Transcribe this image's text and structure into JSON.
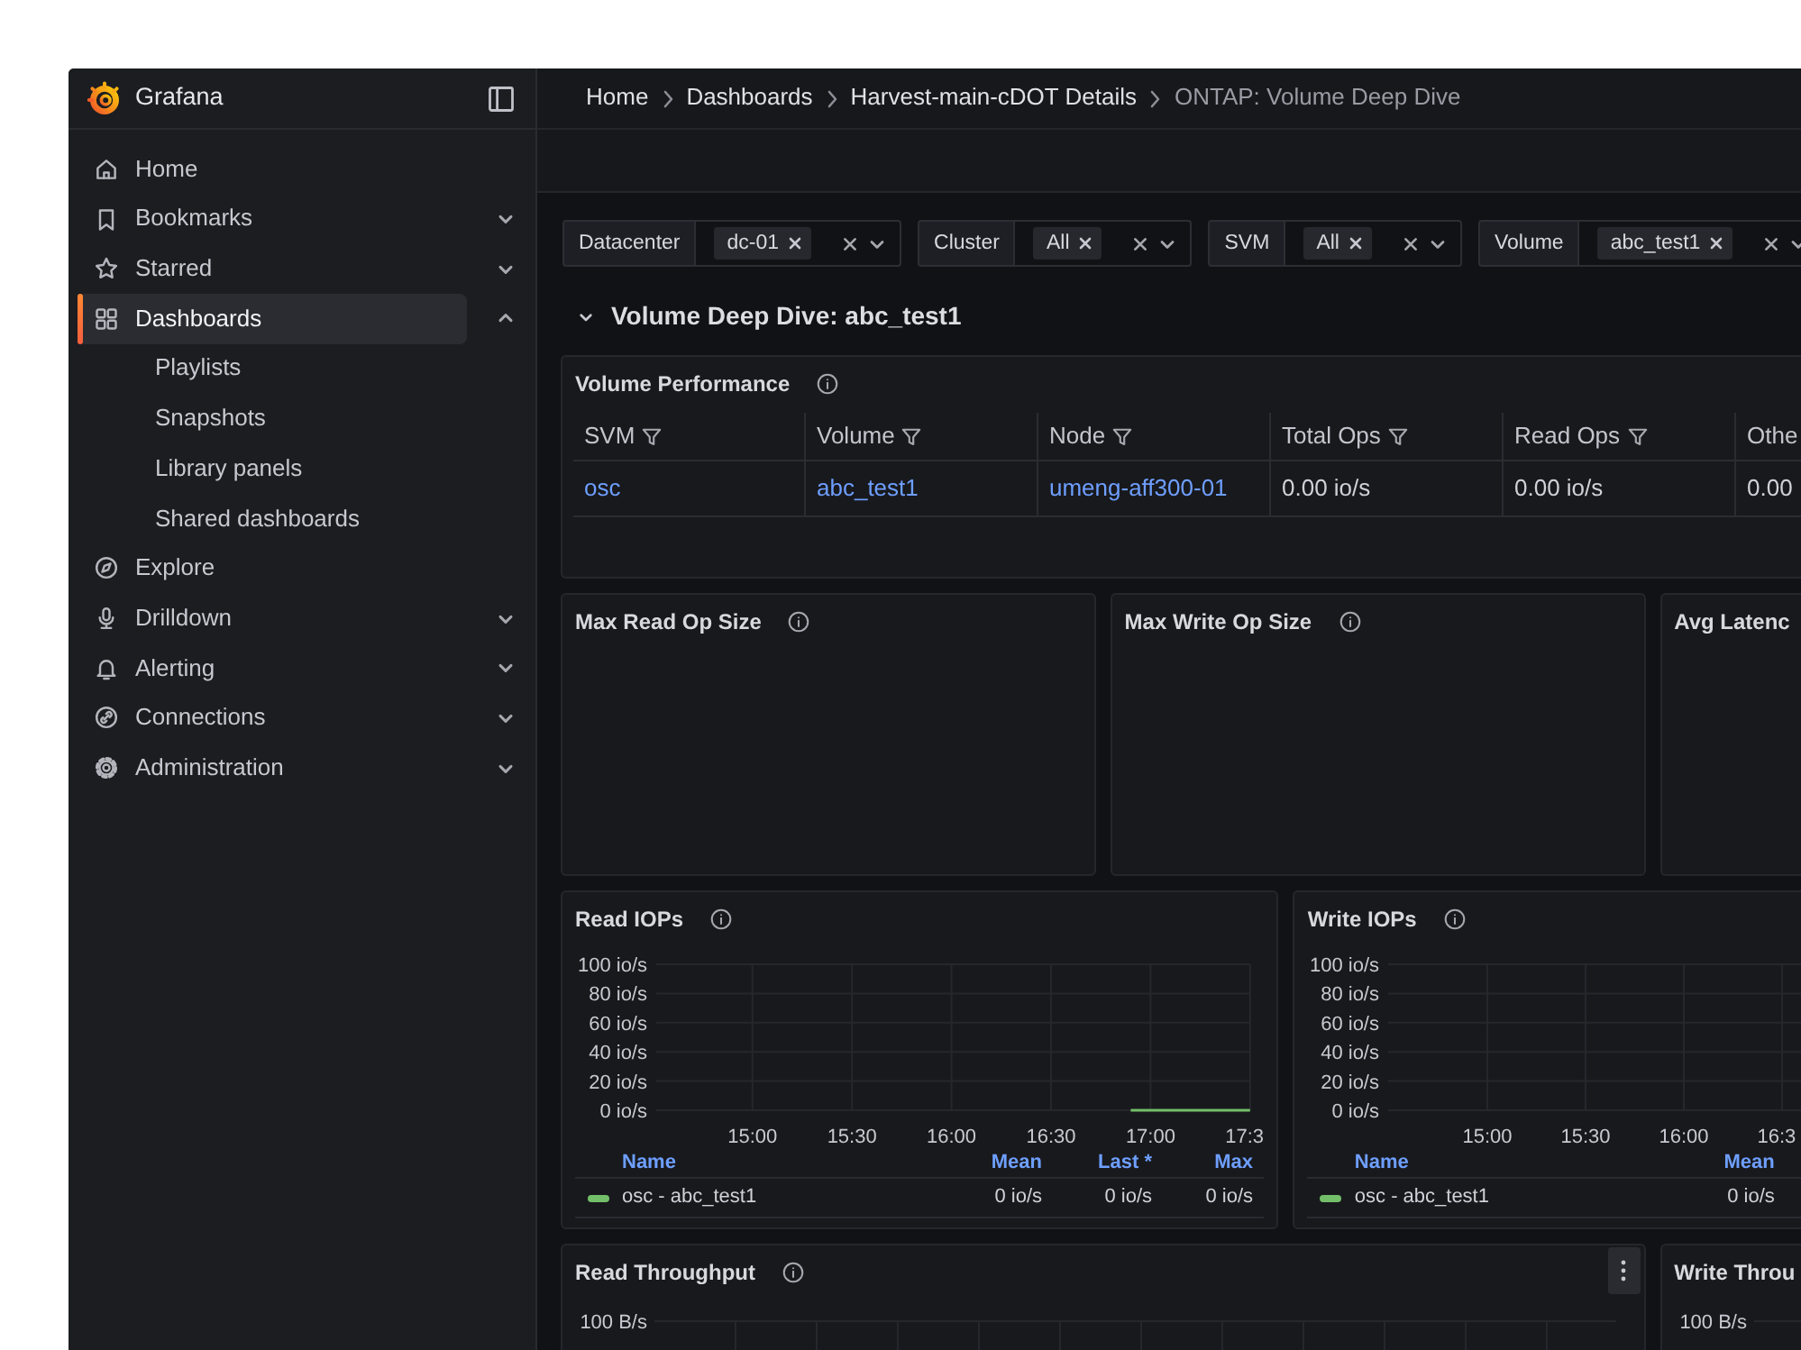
{
  "sidebar": {
    "brand": "Grafana",
    "items": [
      {
        "label": "Home",
        "kind": "link",
        "selected": false
      },
      {
        "label": "Bookmarks",
        "kind": "group",
        "selected": false,
        "expanded": false
      },
      {
        "label": "Starred",
        "kind": "group",
        "selected": false,
        "expanded": false
      },
      {
        "label": "Dashboards",
        "kind": "group",
        "selected": true,
        "expanded": true,
        "children": [
          {
            "label": "Playlists",
            "selected": false
          },
          {
            "label": "Snapshots",
            "selected": false
          },
          {
            "label": "Library panels",
            "selected": false
          },
          {
            "label": "Shared dashboards",
            "selected": false
          }
        ]
      },
      {
        "label": "Explore",
        "kind": "link",
        "selected": false
      },
      {
        "label": "Drilldown",
        "kind": "group",
        "selected": false,
        "expanded": false
      },
      {
        "label": "Alerting",
        "kind": "group",
        "selected": false,
        "expanded": false
      },
      {
        "label": "Connections",
        "kind": "group",
        "selected": false,
        "expanded": false
      },
      {
        "label": "Administration",
        "kind": "group",
        "selected": false,
        "expanded": false
      }
    ]
  },
  "breadcrumbs": [
    {
      "label": "Home",
      "selected": false
    },
    {
      "label": "Dashboards",
      "selected": false
    },
    {
      "label": "Harvest-main-cDOT Details",
      "selected": false
    },
    {
      "label": "ONTAP: Volume Deep Dive",
      "selected": true
    }
  ],
  "variables": [
    {
      "label": "Datacenter",
      "values": [
        "dc-01"
      ]
    },
    {
      "label": "Cluster",
      "values": [
        "All"
      ]
    },
    {
      "label": "SVM",
      "values": [
        "All"
      ]
    },
    {
      "label": "Volume",
      "values": [
        "abc_test1"
      ]
    }
  ],
  "section": {
    "title": "Volume Deep Dive: abc_test1",
    "expanded": true
  },
  "panel_rows": [
    [
      {
        "kind": "table",
        "title": "Volume Performance",
        "info": true,
        "table": {
          "columns": [
            {
              "label": "SVM",
              "filter": true
            },
            {
              "label": "Volume",
              "filter": true
            },
            {
              "label": "Node",
              "filter": true
            },
            {
              "label": "Total Ops",
              "filter": true
            },
            {
              "label": "Read Ops",
              "filter": true
            },
            {
              "label": "Othe"
            }
          ],
          "rows": [
            [
              {
                "text": "osc",
                "kind": "link"
              },
              {
                "text": "abc_test1",
                "kind": "link"
              },
              {
                "text": "umeng-aff300-01",
                "kind": "link"
              },
              {
                "text": "0.00 io/s",
                "kind": "plain"
              },
              {
                "text": "0.00 io/s",
                "kind": "plain"
              },
              {
                "text": "0.00",
                "kind": "plain"
              }
            ]
          ]
        }
      }
    ],
    [
      {
        "kind": "empty",
        "title": "Max Read Op Size",
        "info": true
      },
      {
        "kind": "empty",
        "title": "Max Write Op Size",
        "info": true
      },
      {
        "kind": "empty",
        "title": "Avg Latenc"
      }
    ],
    [
      {
        "kind": "timeseries",
        "title": "Read IOPs",
        "info": true,
        "chart_data": {
          "type": "line",
          "x": [
            1014,
            1050
          ],
          "series": [
            {
              "color": "#73bf69",
              "values": [
                0,
                0
              ]
            }
          ],
          "xlim": [
            871,
            1050
          ],
          "ylim": [
            0,
            100
          ],
          "xticks": [
            {
              "value": 900,
              "label": "15:00"
            },
            {
              "value": 930,
              "label": "15:30"
            },
            {
              "value": 960,
              "label": "16:00"
            },
            {
              "value": 990,
              "label": "16:30"
            },
            {
              "value": 1020,
              "label": "17:00"
            },
            {
              "value": 1050,
              "label": "17:3"
            }
          ],
          "yticks": [
            {
              "value": 0,
              "label": "0 io/s"
            },
            {
              "value": 20,
              "label": "20 io/s"
            },
            {
              "value": 40,
              "label": "40 io/s"
            },
            {
              "value": 60,
              "label": "60 io/s"
            },
            {
              "value": 80,
              "label": "80 io/s"
            },
            {
              "value": 100,
              "label": "100 io/s"
            }
          ],
          "grid": true
        },
        "legend": {
          "columns": [
            "Name",
            "Mean",
            "Last *",
            "Max"
          ],
          "rows": [
            [
              "osc - abc_test1",
              "0 io/s",
              "0 io/s",
              "0 io/s"
            ]
          ]
        }
      },
      {
        "kind": "timeseries",
        "title": "Write IOPs",
        "info": true,
        "chart_data": {
          "type": "line",
          "categories": [
            "15:00",
            "15:30",
            "16:00",
            "16:3"
          ],
          "series": [
            {
              "color": "#73bf69",
              "values": [
                null,
                null,
                null,
                null
              ]
            }
          ],
          "ylim": [
            0,
            100
          ],
          "yticks": [
            {
              "value": 0,
              "label": "0 io/s"
            },
            {
              "value": 20,
              "label": "20 io/s"
            },
            {
              "value": 40,
              "label": "40 io/s"
            },
            {
              "value": 60,
              "label": "60 io/s"
            },
            {
              "value": 80,
              "label": "80 io/s"
            },
            {
              "value": 100,
              "label": "100 io/s"
            }
          ],
          "grid": true
        },
        "legend": {
          "columns": [
            "Name",
            "Mean"
          ],
          "rows": [
            [
              "osc - abc_test1",
              "0 io/s"
            ]
          ]
        }
      }
    ],
    [
      {
        "kind": "grid",
        "title": "Read Throughput",
        "info": true,
        "menu": true,
        "y_labels": [
          "100 B/s"
        ]
      },
      {
        "kind": "grid",
        "title": "Write Throu",
        "y_labels": [
          "100 B/s"
        ]
      }
    ]
  ]
}
